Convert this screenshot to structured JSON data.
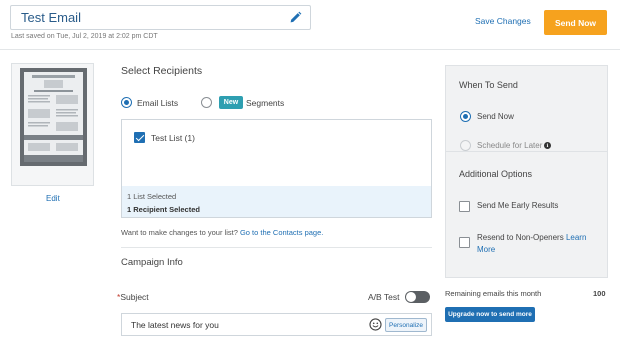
{
  "header": {
    "title": "Test Email",
    "saved_text": "Last saved on Tue, Jul 2, 2019 at 2:02 pm CDT",
    "save_changes": "Save Changes",
    "send_now": "Send Now"
  },
  "thumbnail": {
    "edit_label": "Edit"
  },
  "recipients": {
    "heading": "Select Recipients",
    "email_lists_label": "Email Lists",
    "new_badge": "New",
    "segments_label": "Segments",
    "lists": [
      {
        "label": "Test List (1)",
        "checked": true
      }
    ],
    "lists_selected": "1 List Selected",
    "recipients_selected": "1 Recipient Selected",
    "change_prefix": "Want to make changes to your list?",
    "change_link": "Go to the Contacts page."
  },
  "campaign": {
    "heading": "Campaign Info",
    "subject_required": "*",
    "subject_label": "Subject",
    "ab_test_label": "A/B Test",
    "ab_test_on": false,
    "subject_value": "The latest news for you",
    "personalize_label": "Personalize"
  },
  "when_to_send": {
    "heading": "When To Send",
    "send_now_label": "Send Now",
    "schedule_label": "Schedule for Later",
    "additional_heading": "Additional Options",
    "early_results_label": "Send Me Early Results",
    "resend_label": "Resend to Non-Openers",
    "learn_more_a": "Learn",
    "learn_more_b": "More"
  },
  "quota": {
    "remaining_label": "Remaining emails this month",
    "remaining_value": "100",
    "upgrade_label": "Upgrade now to send more"
  },
  "colors": {
    "accent": "#1f6fb3",
    "send_button": "#f6a21e",
    "new_badge": "#2e9fb1"
  }
}
